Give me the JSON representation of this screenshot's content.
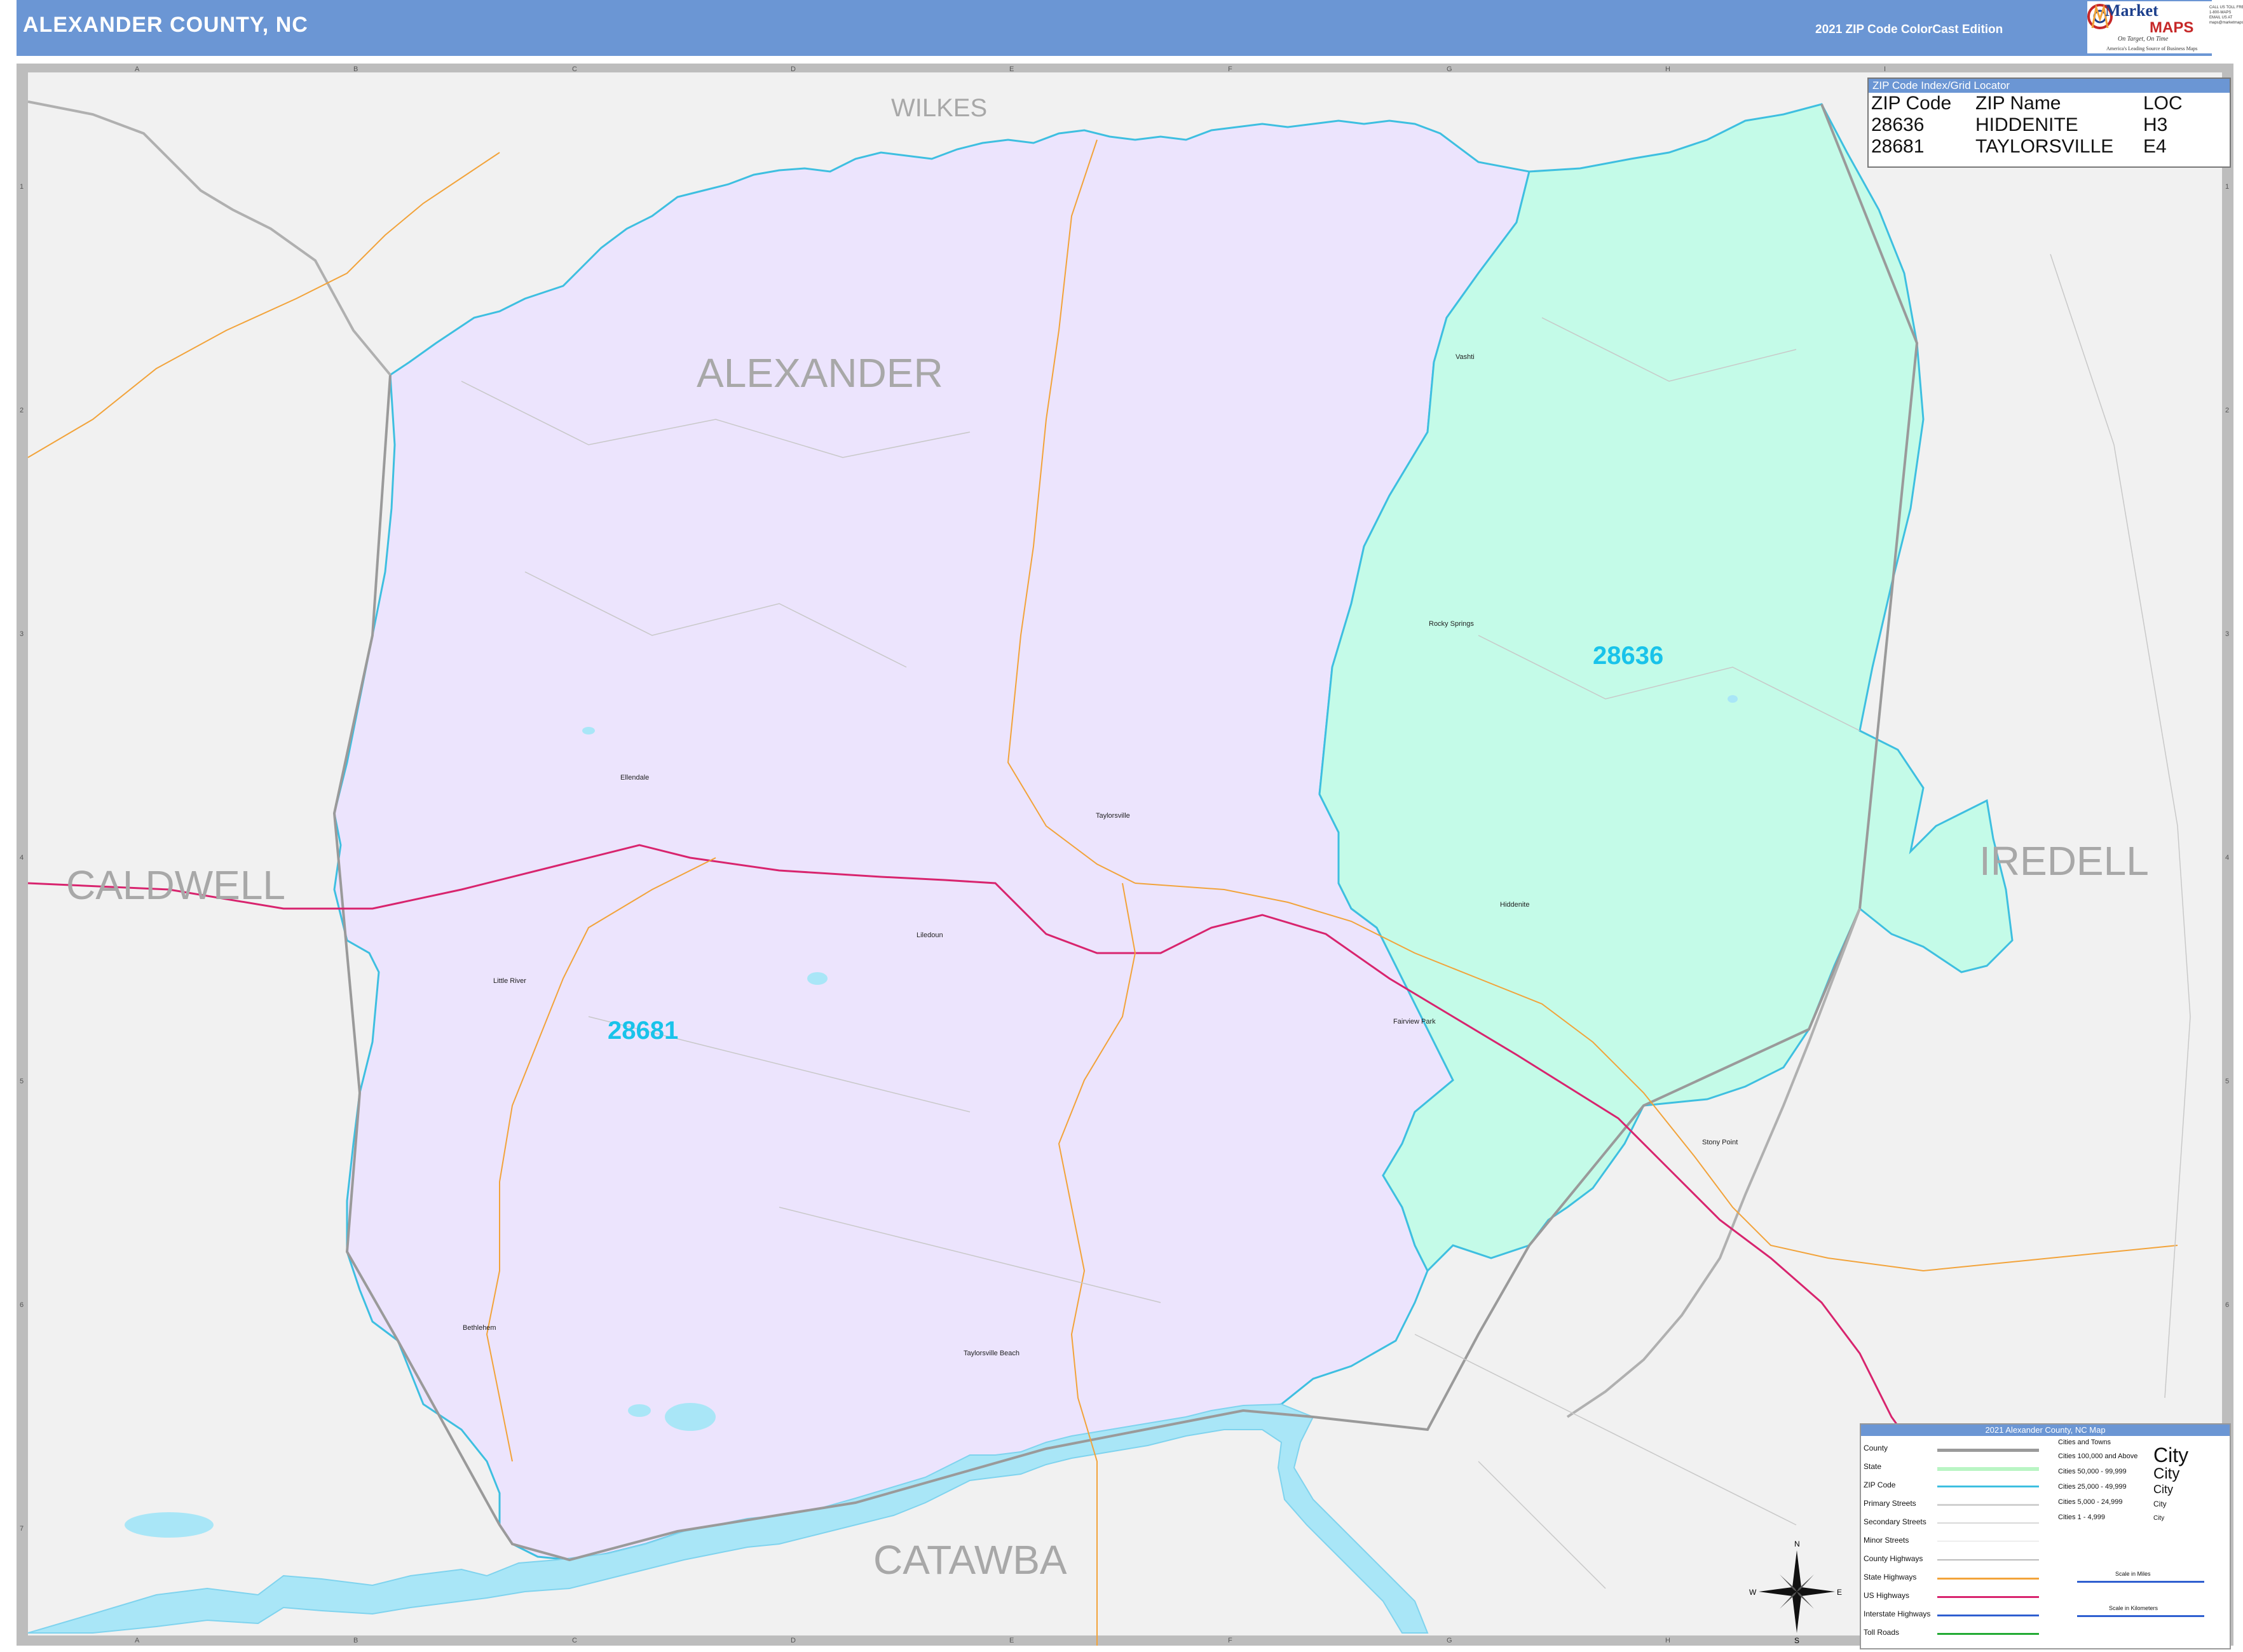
{
  "header": {
    "title": "ALEXANDER COUNTY, NC",
    "edition": "2021 ZIP Code ColorCast Edition",
    "logo": {
      "brand_top": "Market",
      "brand_bottom": "MAPS",
      "tagline": "On Target, On Time",
      "subtitle": "America's Leading Source of Business Maps",
      "contact": [
        "CALL US TOLL FREE",
        "1-800-MAPS",
        "EMAIL US AT",
        "maps@marketmaps.com"
      ]
    }
  },
  "colors": {
    "header_bg": "#6b96d4",
    "zip_28681_fill": "#ece4fd",
    "zip_28636_fill": "#c4fbe8",
    "zip_boundary": "#3ebfe0",
    "county_boundary": "#9a9a9a",
    "water": "#a9e6f7",
    "us_highway": "#d8246e",
    "state_highway": "#f2a33a",
    "background": "#f1f1f1"
  },
  "grid": {
    "columns": [
      "A",
      "B",
      "C",
      "D",
      "E",
      "F",
      "G",
      "H",
      "I"
    ],
    "rows": [
      "1",
      "2",
      "3",
      "4",
      "5",
      "6",
      "7"
    ]
  },
  "zip_index": {
    "title": "ZIP Code Index/Grid Locator",
    "headers": [
      "ZIP Code",
      "ZIP Name",
      "LOC"
    ],
    "rows": [
      [
        "28636",
        "HIDDENITE",
        "H3"
      ],
      [
        "28681",
        "TAYLORSVILLE",
        "E4"
      ]
    ]
  },
  "counties": {
    "wilkes": "WILKES",
    "alexander": "ALEXANDER",
    "caldwell": "CALDWELL",
    "iredell": "IREDELL",
    "catawba": "CATAWBA"
  },
  "zip_labels": {
    "z28636": "28636",
    "z28681": "28681"
  },
  "places": {
    "vashti": "Vashti",
    "rocky_springs": "Rocky Springs",
    "ellendale": "Ellendale",
    "taylorsville": "Taylorsville",
    "hiddenite": "Hiddenite",
    "liledoun": "Liledoun",
    "little_river": "Little River",
    "fairview_park": "Fairview Park",
    "stony_point": "Stony Point",
    "bethlehem": "Bethlehem",
    "taylorsville_beach": "Taylorsville Beach"
  },
  "legend": {
    "title": "2021 Alexander County, NC Map",
    "items": [
      "County",
      "State",
      "ZIP Code",
      "Primary Streets",
      "Secondary Streets",
      "Minor Streets",
      "County Highways",
      "State Highways",
      "US Highways",
      "Interstate Highways",
      "Toll Roads"
    ],
    "cities_header": "Cities and Towns",
    "city_classes": [
      "Cities 100,000 and Above",
      "Cities 50,000 - 99,999",
      "Cities 25,000 - 49,999",
      "Cities 5,000 - 24,999",
      "Cities 1 - 4,999"
    ],
    "city_sample": "City",
    "scale_miles": "Scale in Miles",
    "scale_km": "Scale in Kilometers"
  },
  "compass": {
    "n": "N",
    "s": "S",
    "e": "E",
    "w": "W"
  }
}
